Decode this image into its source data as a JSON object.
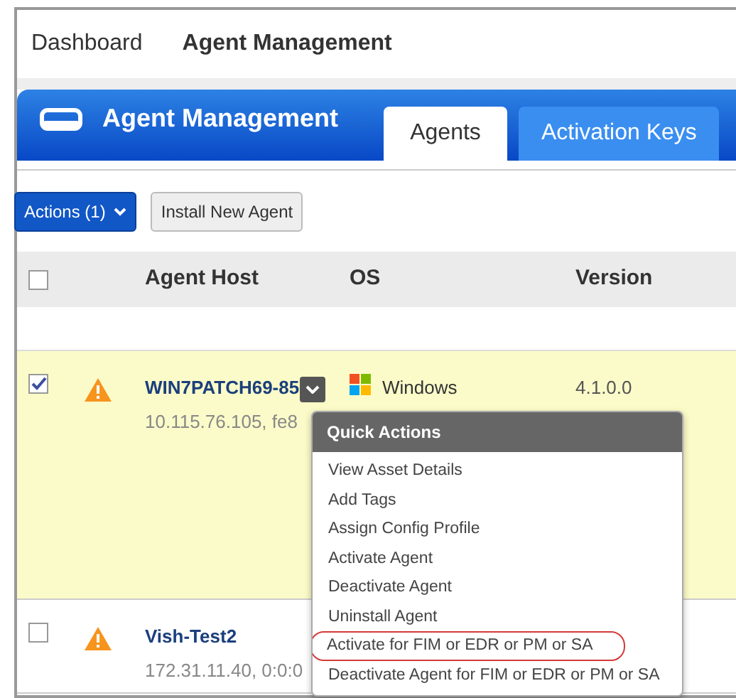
{
  "breadcrumb": [
    {
      "label": "Dashboard",
      "current": false
    },
    {
      "label": "Agent Management",
      "current": true
    }
  ],
  "header": {
    "title": "Agent Management"
  },
  "tabs": [
    {
      "label": "Agents",
      "selected": true
    },
    {
      "label": "Activation Keys",
      "selected": false
    }
  ],
  "toolbar": {
    "actions_button": "Actions (1)",
    "install_button": "Install New Agent"
  },
  "table": {
    "header_checked": false,
    "columns": [
      "Agent Host",
      "OS",
      "Version"
    ],
    "rows": [
      {
        "checked": true,
        "selected": true,
        "host": "WIN7PATCH69-85",
        "address": "10.115.76.105, fe8",
        "os": "Windows",
        "version": "4.1.0.0",
        "menu_open": true
      },
      {
        "checked": false,
        "selected": false,
        "host": "Vish-Test2",
        "address": "172.31.11.40, 0:0:0",
        "menu_open": false
      }
    ]
  },
  "quick_actions": {
    "title": "Quick Actions",
    "items": [
      {
        "label": "View Asset Details",
        "highlighted": false
      },
      {
        "label": "Add Tags",
        "highlighted": false
      },
      {
        "label": "Assign Config Profile",
        "highlighted": false
      },
      {
        "label": "Activate Agent",
        "highlighted": false
      },
      {
        "label": "Deactivate Agent",
        "highlighted": false
      },
      {
        "label": "Uninstall Agent",
        "highlighted": false
      },
      {
        "label": "Activate for FIM or EDR or PM or SA",
        "highlighted": true
      },
      {
        "label": "Deactivate Agent for FIM or EDR or PM or SA",
        "highlighted": false
      }
    ]
  }
}
